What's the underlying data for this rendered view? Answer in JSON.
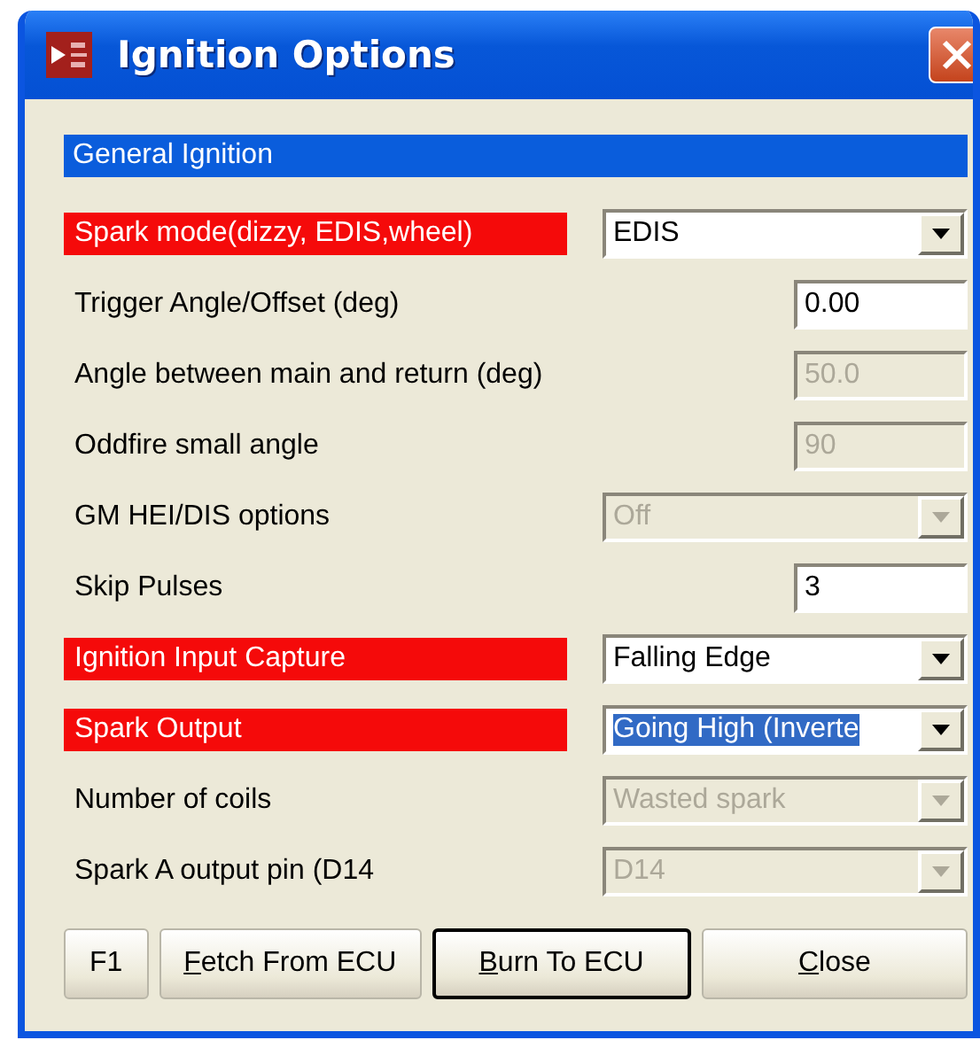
{
  "window": {
    "title": "Ignition Options"
  },
  "section": {
    "title": "General Ignition"
  },
  "fields": [
    {
      "label": "Spark mode(dizzy, EDIS,wheel)",
      "kind": "combo",
      "value": "EDIS",
      "highlighted": true,
      "disabled": false,
      "selected": false
    },
    {
      "label": "Trigger Angle/Offset (deg)",
      "kind": "text",
      "value": "0.00",
      "highlighted": false,
      "disabled": false,
      "selected": false
    },
    {
      "label": "Angle between main and return (deg)",
      "kind": "text",
      "value": "50.0",
      "highlighted": false,
      "disabled": true,
      "selected": false
    },
    {
      "label": "Oddfire small angle",
      "kind": "text",
      "value": "90",
      "highlighted": false,
      "disabled": true,
      "selected": false
    },
    {
      "label": "GM HEI/DIS options",
      "kind": "combo",
      "value": "Off",
      "highlighted": false,
      "disabled": true,
      "selected": false
    },
    {
      "label": "Skip Pulses",
      "kind": "text",
      "value": "3",
      "highlighted": false,
      "disabled": false,
      "selected": false
    },
    {
      "label": "Ignition Input Capture",
      "kind": "combo",
      "value": "Falling Edge",
      "highlighted": true,
      "disabled": false,
      "selected": false
    },
    {
      "label": "Spark Output",
      "kind": "combo",
      "value": "Going High (Inverte",
      "highlighted": true,
      "disabled": false,
      "selected": true
    },
    {
      "label": "Number of coils",
      "kind": "combo",
      "value": "Wasted spark",
      "highlighted": false,
      "disabled": true,
      "selected": false
    },
    {
      "label": "Spark A output pin (D14",
      "kind": "combo",
      "value": "D14",
      "highlighted": false,
      "disabled": true,
      "selected": false
    }
  ],
  "buttons": [
    {
      "label": "F1",
      "underline_first": false,
      "default": false
    },
    {
      "label": "Fetch From ECU",
      "underline_first": true,
      "default": false
    },
    {
      "label": "Burn To ECU",
      "underline_first": true,
      "default": true
    },
    {
      "label": "Close",
      "underline_first": true,
      "default": false
    }
  ]
}
